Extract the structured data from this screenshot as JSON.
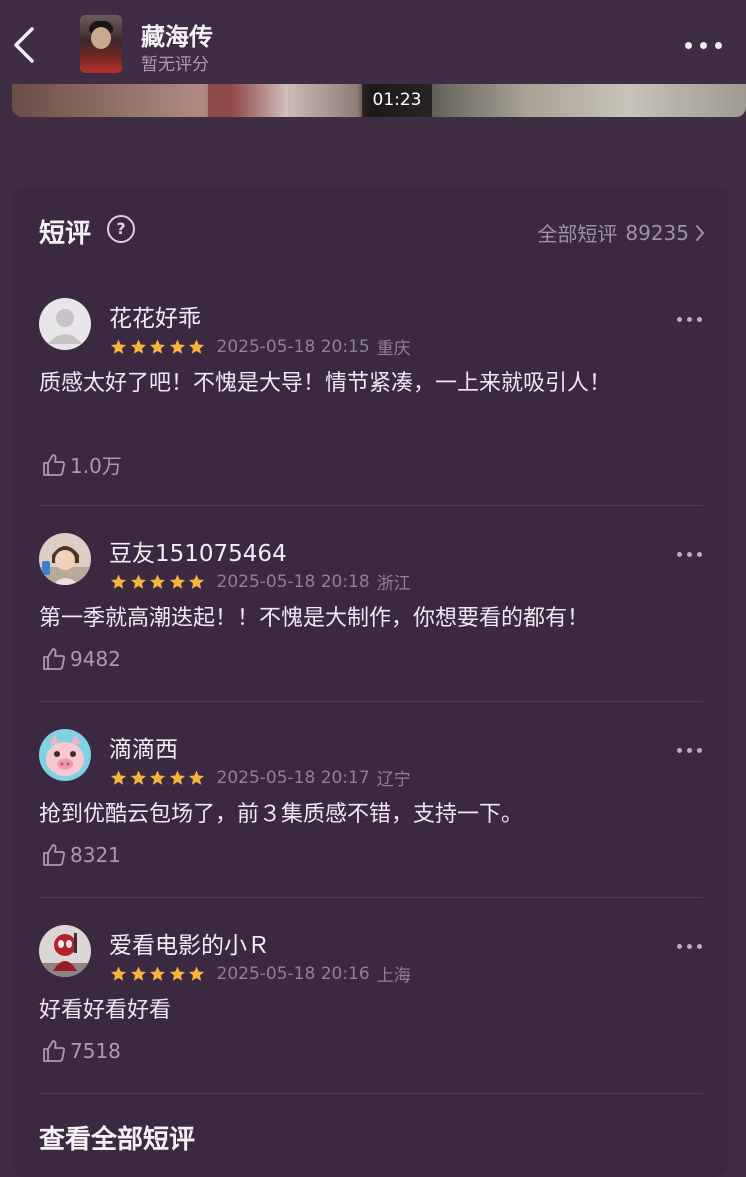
{
  "header": {
    "title": "藏海传",
    "subtitle": "暂无评分",
    "back_icon": "chevron-left-icon",
    "more_icon": "more-horizontal-icon"
  },
  "video": {
    "duration": "01:23"
  },
  "section": {
    "title": "短评",
    "all_label": "全部短评",
    "all_count": "89235",
    "view_all_label": "查看全部短评"
  },
  "reviews": [
    {
      "username": "花花好乖",
      "rating": 5,
      "date": "2025-05-18 20:15",
      "location": "重庆",
      "content": "质感太好了吧！不愧是大导！情节紧凑，一上来就吸引人！",
      "likes": "1.0万"
    },
    {
      "username": "豆友151075464",
      "rating": 5,
      "date": "2025-05-18 20:18",
      "location": "浙江",
      "content": "第一季就高潮迭起！！不愧是大制作，你想要看的都有！",
      "likes": "9482"
    },
    {
      "username": "滴滴西",
      "rating": 5,
      "date": "2025-05-18 20:17",
      "location": "辽宁",
      "content": "抢到优酷云包场了，前３集质感不错，支持一下。",
      "likes": "8321"
    },
    {
      "username": "爱看电影的小Ｒ",
      "rating": 5,
      "date": "2025-05-18 20:16",
      "location": "上海",
      "content": "好看好看好看",
      "likes": "7518"
    }
  ],
  "colors": {
    "background": "#3e2d44",
    "card": "#3a2940",
    "star": "#f4b43c",
    "muted_text": "#8e8294"
  }
}
